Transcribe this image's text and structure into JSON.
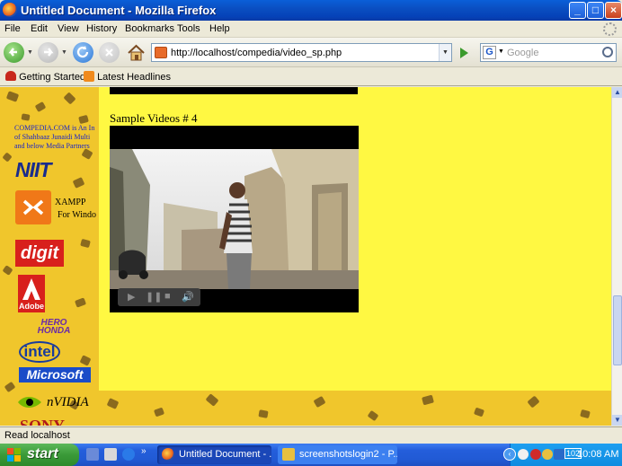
{
  "window": {
    "title": "Untitled Document - Mozilla Firefox"
  },
  "menu": [
    "File",
    "Edit",
    "View",
    "History",
    "Bookmarks",
    "Tools",
    "Help"
  ],
  "nav": {
    "url": "http://localhost/compedia/video_sp.php",
    "search_placeholder": "Google",
    "search_engine": "G"
  },
  "bookmarks": [
    "Getting Started",
    "Latest Headlines"
  ],
  "page": {
    "company_info": [
      "COMPEDIA.COM is An In",
      "of Shahbaaz Junaidi Multi",
      "and below Media Partners"
    ],
    "logos": {
      "niit": "NIIT",
      "xampp": "XAMPP",
      "xampp_sub": "For Windo",
      "digit": "digit",
      "adobe": "Adobe",
      "hero_1": "HERO",
      "hero_2": "HONDA",
      "intel": "intel",
      "microsoft": "Microsoft",
      "nvidia": "nVIDIA",
      "sony": "SONY"
    },
    "sample_heading": "Sample Videos # 4"
  },
  "status": "Read localhost",
  "taskbar": {
    "start": "start",
    "tasks": [
      "Untitled Document - ...",
      "screenshotslogin2 - P..."
    ],
    "clock": "10:08 AM",
    "tray_badge": "102"
  },
  "colors": {
    "page_bg": "#fff842",
    "strip": "#f0c62c",
    "leaf": "#8a6a1e",
    "company_text": "#1a24c8"
  }
}
